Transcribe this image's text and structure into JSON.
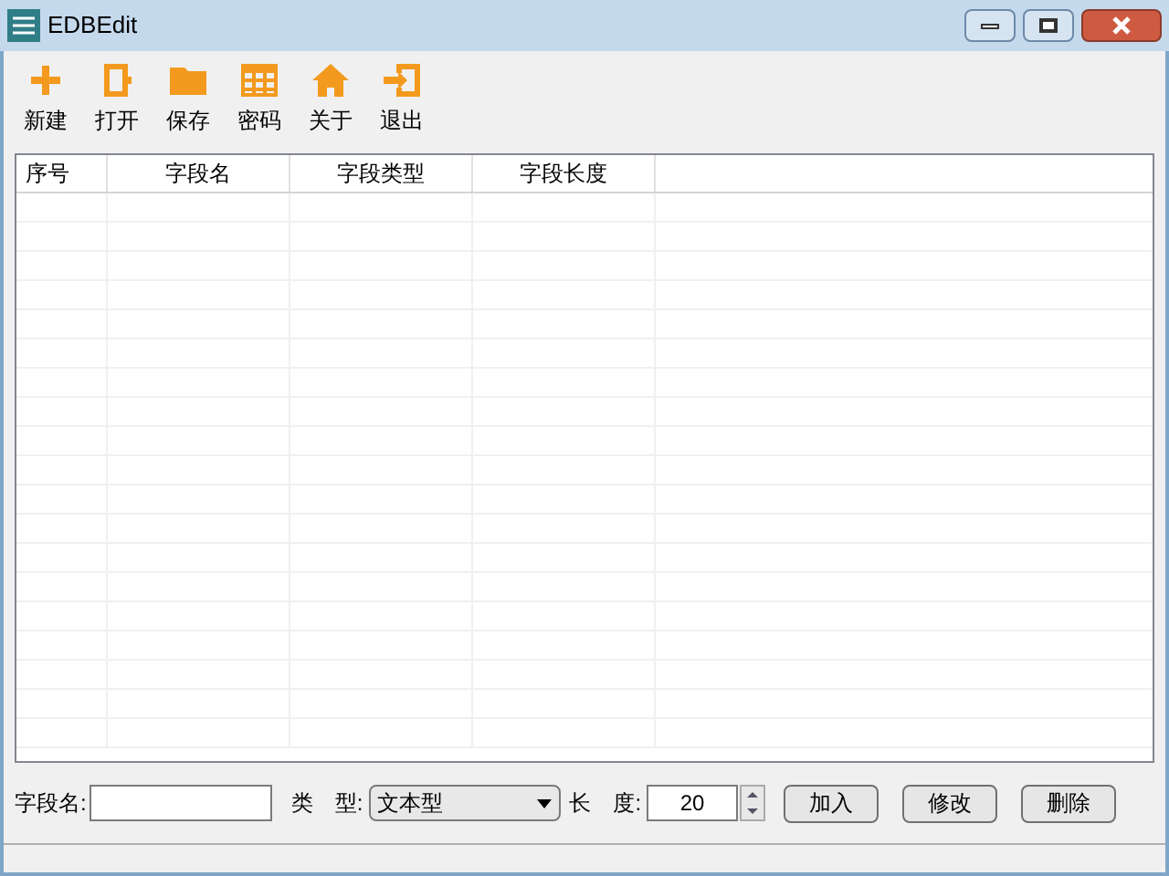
{
  "window": {
    "title": "EDBEdit"
  },
  "toolbar": [
    {
      "label": "新建"
    },
    {
      "label": "打开"
    },
    {
      "label": "保存"
    },
    {
      "label": "密码"
    },
    {
      "label": "关于"
    },
    {
      "label": "退出"
    }
  ],
  "table": {
    "columns": [
      "序号",
      "字段名",
      "字段类型",
      "字段长度"
    ]
  },
  "form": {
    "name_label": "字段名:",
    "type_label": "类　型:",
    "type_value": "文本型",
    "length_label": "长　度:",
    "length_value": "20",
    "buttons": [
      "加入",
      "修改",
      "删除"
    ]
  }
}
